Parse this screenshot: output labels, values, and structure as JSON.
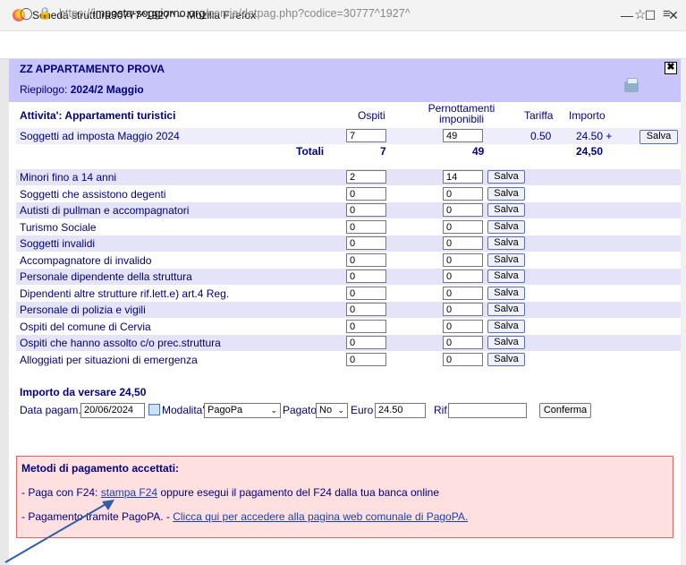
{
  "window": {
    "title": "Scheda struttura30777^1927^ – Mozilla Firefox",
    "url_prefix": "https://",
    "url_domain": "imposta-soggiorno.org",
    "url_path": "/cervia/detpag.php?codice=30777^1927^"
  },
  "header": {
    "title": "ZZ APPARTAMENTO PROVA",
    "summary_label": "Riepilogo:",
    "summary_value": "2024/2 Maggio"
  },
  "table": {
    "activity": "Attivita': Appartamenti turistici",
    "col_guests": "Ospiti",
    "col_nights": "Pernottamenti imponibili",
    "col_rate": "Tariffa",
    "col_amount": "Importo",
    "main_row": {
      "label": "Soggetti ad imposta Maggio 2024",
      "guests": "7",
      "nights": "49",
      "rate": "0.50",
      "amount": "24.50 +",
      "save": "Salva"
    },
    "totals": {
      "label": "Totali",
      "guests": "7",
      "nights": "49",
      "amount": "24,50"
    }
  },
  "exempt_rows": [
    {
      "label": "Minori fino a 14 anni",
      "guests": "2",
      "nights": "14",
      "save": "Salva"
    },
    {
      "label": "Soggetti che assistono degenti",
      "guests": "0",
      "nights": "0",
      "save": "Salva"
    },
    {
      "label": "Autisti di pullman e accompagnatori",
      "guests": "0",
      "nights": "0",
      "save": "Salva"
    },
    {
      "label": "Turismo Sociale",
      "guests": "0",
      "nights": "0",
      "save": "Salva"
    },
    {
      "label": "Soggetti invalidi",
      "guests": "0",
      "nights": "0",
      "save": "Salva"
    },
    {
      "label": "Accompagnatore di invalido",
      "guests": "0",
      "nights": "0",
      "save": "Salva"
    },
    {
      "label": "Personale dipendente della struttura",
      "guests": "0",
      "nights": "0",
      "save": "Salva"
    },
    {
      "label": "Dipendenti altre strutture rif.lett.e) art.4 Reg.",
      "guests": "0",
      "nights": "0",
      "save": "Salva"
    },
    {
      "label": "Personale di polizia e vigili",
      "guests": "0",
      "nights": "0",
      "save": "Salva"
    },
    {
      "label": "Ospiti del comune di Cervia",
      "guests": "0",
      "nights": "0",
      "save": "Salva"
    },
    {
      "label": "Ospiti che hanno assolto c/o prec.struttura",
      "guests": "0",
      "nights": "0",
      "save": "Salva"
    },
    {
      "label": "Alloggiati per situazioni di emergenza",
      "guests": "0",
      "nights": "0",
      "save": "Salva"
    }
  ],
  "payment": {
    "due": "Importo da versare 24,50",
    "date_label": "Data pagam.",
    "date_value": "20/06/2024",
    "mode_label": "Modalita'",
    "mode_value": "PagoPa",
    "paid_label": "Pagato",
    "paid_value": "No",
    "euro_label": "Euro",
    "euro_value": "24.50",
    "ref_label": "Rif.",
    "ref_value": "",
    "confirm": "Conferma"
  },
  "methods": {
    "title": "Metodi di pagamento accettati:",
    "f24_pre": "- Paga con F24:",
    "f24_link": "stampa F24",
    "f24_post": "oppure esegui il pagamento del F24 dalla tua banca online",
    "pagopa_pre": "- Pagamento tramite PagoPA. -",
    "pagopa_link": "Clicca qui per accedere alla pagina web comunale di PagoPA."
  },
  "colors": {
    "header_bg": "#c7c5f9",
    "row_band": "#e4e3f7",
    "text_blue": "#000080",
    "arrow": "#2e5fa8"
  }
}
